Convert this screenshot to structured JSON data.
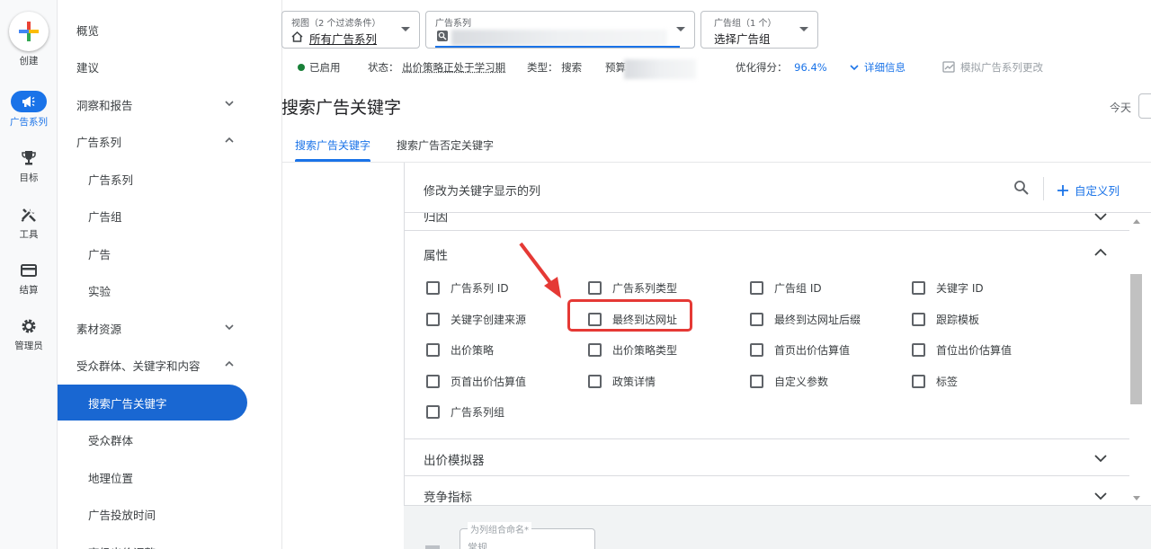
{
  "rail": {
    "create_label": "创建",
    "campaigns_label": "广告系列",
    "goals_label": "目标",
    "tools_label": "工具",
    "billing_label": "结算",
    "admin_label": "管理员"
  },
  "nav": {
    "overview": "概览",
    "recommendations": "建议",
    "insights": "洞察和报告",
    "campaigns_group": "广告系列",
    "campaigns": "广告系列",
    "ad_groups": "广告组",
    "ads": "广告",
    "experiments": "实验",
    "assets": "素材资源",
    "audiences_group": "受众群体、关键字和内容",
    "search_keywords": "搜索广告关键字",
    "audiences": "受众群体",
    "locations": "地理位置",
    "ad_schedule": "广告投放时间",
    "advanced_bid": "高级出价调整"
  },
  "topbar": {
    "view_small": "视图（2 个过滤条件）",
    "view_main": "所有广告系列",
    "campaign_small": "广告系列",
    "adgroup_small": "广告组（1 个）",
    "adgroup_main": "选择广告组"
  },
  "status": {
    "enabled": "已启用",
    "state_label": "状态：",
    "state_value": "出价策略正处于学习期",
    "type_label": "类型：",
    "type_value": "搜索",
    "budget_label": "预算",
    "optimization_label": "优化得分：",
    "optimization_value": "96.4%",
    "details": "详细信息",
    "simulate": "模拟广告系列更改"
  },
  "page": {
    "title": "搜索广告关键字",
    "today": "今天",
    "tab_keywords": "搜索广告关键字",
    "tab_negative": "搜索广告否定关键字"
  },
  "panel": {
    "title": "修改为关键字显示的列",
    "custom_columns": "自定义列",
    "section_attribution": "归因",
    "section_attributes": "属性",
    "section_bid_simulator": "出价模拟器",
    "section_competitive": "竞争指标",
    "attributes": [
      [
        "广告系列 ID",
        "广告系列类型",
        "广告组 ID",
        "关键字 ID"
      ],
      [
        "关键字创建来源",
        "最终到达网址",
        "最终到达网址后缀",
        "跟踪模板"
      ],
      [
        "出价策略",
        "出价策略类型",
        "首页出价估算值",
        "首位出价估算值"
      ],
      [
        "页首出价估算值",
        "政策详情",
        "自定义参数",
        "标签"
      ],
      [
        "广告系列组"
      ]
    ],
    "name_field_label": "为列组合命名*",
    "name_field_value": "常规"
  }
}
